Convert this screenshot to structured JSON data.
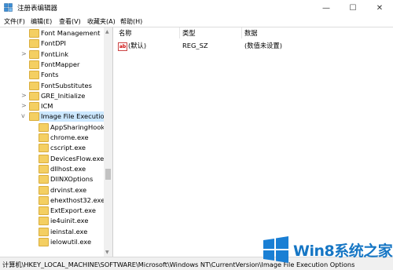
{
  "window": {
    "title": "注册表编辑器"
  },
  "window_buttons": {
    "minimize": "—",
    "maximize": "☐",
    "close": "✕"
  },
  "menu": [
    {
      "label": "文件(F)"
    },
    {
      "label": "编辑(E)"
    },
    {
      "label": "查看(V)"
    },
    {
      "label": "收藏夹(A)"
    },
    {
      "label": "帮助(H)"
    }
  ],
  "tree": [
    {
      "label": "Font Management",
      "expander": ""
    },
    {
      "label": "FontDPI",
      "expander": ""
    },
    {
      "label": "FontLink",
      "expander": ">"
    },
    {
      "label": "FontMapper",
      "expander": ""
    },
    {
      "label": "Fonts",
      "expander": ""
    },
    {
      "label": "FontSubstitutes",
      "expander": ""
    },
    {
      "label": "GRE_Initialize",
      "expander": ">"
    },
    {
      "label": "ICM",
      "expander": ">"
    },
    {
      "label": "Image File Execution",
      "expander": "v",
      "selected": true
    },
    {
      "label": "AppSharingHook",
      "expander": ""
    },
    {
      "label": "chrome.exe",
      "expander": ""
    },
    {
      "label": "cscript.exe",
      "expander": ""
    },
    {
      "label": "DevicesFlow.exe",
      "expander": ""
    },
    {
      "label": "dllhost.exe",
      "expander": ""
    },
    {
      "label": "DllNXOptions",
      "expander": ""
    },
    {
      "label": "drvinst.exe",
      "expander": ""
    },
    {
      "label": "ehexthost32.exe",
      "expander": ""
    },
    {
      "label": "ExtExport.exe",
      "expander": ""
    },
    {
      "label": "ie4uinit.exe",
      "expander": ""
    },
    {
      "label": "ieinstal.exe",
      "expander": ""
    },
    {
      "label": "ielowutil.exe",
      "expander": ""
    }
  ],
  "columns": {
    "name": "名称",
    "type": "类型",
    "data": "数据"
  },
  "values": [
    {
      "name": "(默认)",
      "type": "REG_SZ",
      "data": "(数值未设置)",
      "icon": "ab"
    }
  ],
  "status": {
    "path": "计算机\\HKEY_LOCAL_MACHINE\\SOFTWARE\\Microsoft\\Windows NT\\CurrentVersion\\Image File Execution Options"
  },
  "watermark": {
    "text": "Win8系统之家"
  },
  "colors": {
    "folder": "#f4cf62",
    "selection": "#cce8ff",
    "watermark": "#1676c4"
  }
}
